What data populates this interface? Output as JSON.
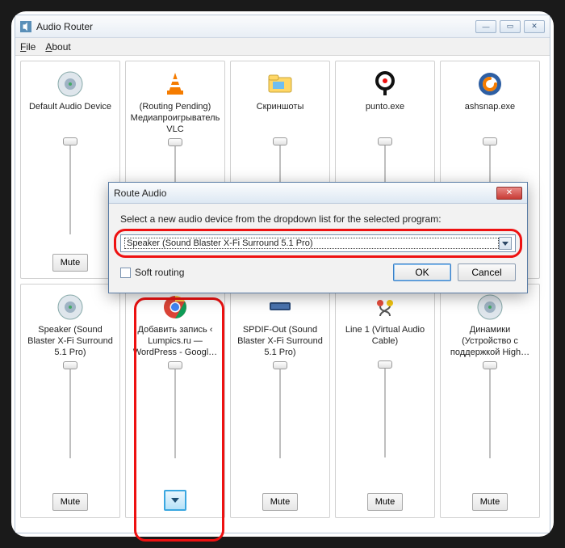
{
  "window": {
    "title": "Audio Router"
  },
  "menus": {
    "file": "File",
    "about": "About"
  },
  "tiles_top": [
    {
      "label": "Default Audio Device",
      "icon": "speaker"
    },
    {
      "label": "(Routing Pending) Медиапроигрыватель VLC",
      "icon": "vlc"
    },
    {
      "label": "Скриншоты",
      "icon": "folder"
    },
    {
      "label": "punto.exe",
      "icon": "punto"
    },
    {
      "label": "ashsnap.exe",
      "icon": "avast"
    }
  ],
  "tiles_bottom": [
    {
      "label": "Speaker (Sound Blaster X-Fi Surround 5.1 Pro)",
      "icon": "speaker"
    },
    {
      "label": "Добавить запись ‹ Lumpics.ru — WordPress - Googl…",
      "icon": "chrome",
      "highlight": true,
      "with_dropdown": true
    },
    {
      "label": "SPDIF-Out (Sound Blaster X-Fi Surround 5.1 Pro)",
      "icon": "sbs"
    },
    {
      "label": "Line 1 (Virtual Audio Cable)",
      "icon": "cable"
    },
    {
      "label": "Динамики (Устройство с поддержкой High…",
      "icon": "speaker"
    }
  ],
  "mute_label": "Mute",
  "dialog": {
    "title": "Route Audio",
    "instruction": "Select a new audio device from the dropdown list for the selected program:",
    "selected_device": "Speaker (Sound Blaster X-Fi Surround 5.1 Pro)",
    "soft_routing": "Soft routing",
    "ok": "OK",
    "cancel": "Cancel"
  }
}
